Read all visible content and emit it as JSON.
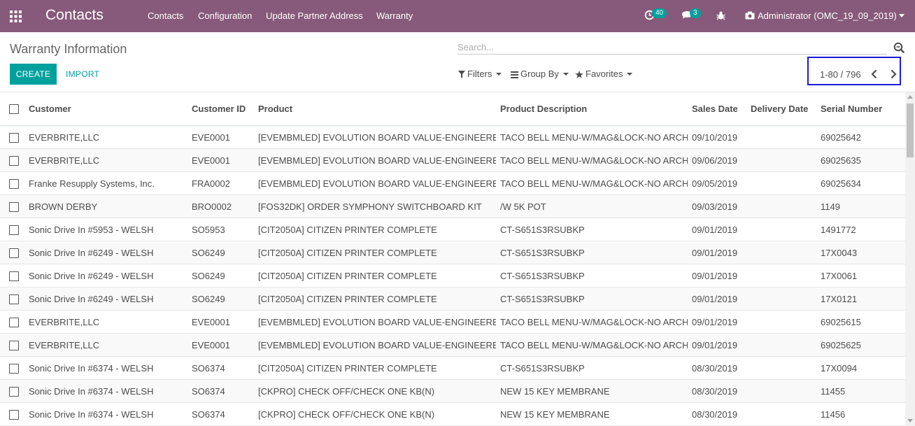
{
  "navbar": {
    "app_title": "Contacts",
    "menu": [
      "Contacts",
      "Configuration",
      "Update Partner Address",
      "Warranty"
    ],
    "activity_count": "40",
    "messages_count": "3",
    "user_label": "Administrator (OMC_19_09_2019)",
    "bg_color": "#875a7b",
    "badge_color": "#00a09d"
  },
  "control_panel": {
    "title": "Warranty Information",
    "search_placeholder": "Search...",
    "create_label": "CREATE",
    "import_label": "IMPORT",
    "filters_label": "Filters",
    "group_by_label": "Group By",
    "favorites_label": "Favorites",
    "pager_value": "1-80 / 796",
    "accent_color": "#00a09d",
    "pager_highlight_color": "#1a1adc"
  },
  "table": {
    "columns": [
      "Customer",
      "Customer ID",
      "Product",
      "Product Description",
      "Sales Date",
      "Delivery Date",
      "Serial Number"
    ],
    "rows": [
      [
        "EVERBRITE,LLC",
        "EVE0001",
        "[EVEMBMLED] EVOLUTION BOARD VALUE-ENGINEERED",
        "TACO BELL MENU-W/MAG&LOCK-NO ARCH",
        "09/10/2019",
        "",
        "69025642"
      ],
      [
        "EVERBRITE,LLC",
        "EVE0001",
        "[EVEMBMLED] EVOLUTION BOARD VALUE-ENGINEERED",
        "TACO BELL MENU-W/MAG&LOCK-NO ARCH",
        "09/06/2019",
        "",
        "69025635"
      ],
      [
        "Franke Resupply Systems, Inc.",
        "FRA0002",
        "[EVEMBMLED] EVOLUTION BOARD VALUE-ENGINEERED",
        "TACO BELL MENU-W/MAG&LOCK-NO ARCH",
        "09/05/2019",
        "",
        "69025634"
      ],
      [
        "BROWN DERBY",
        "BRO0002",
        "[FOS32DK] ORDER SYMPHONY SWITCHBOARD KIT",
        "/W 5K POT",
        "09/03/2019",
        "",
        "1149"
      ],
      [
        "Sonic Drive In #5953 - WELSH",
        "SO5953",
        "[CIT2050A] CITIZEN PRINTER COMPLETE",
        "CT-S651S3RSUBKP",
        "09/01/2019",
        "",
        "1491772"
      ],
      [
        "Sonic Drive In #6249 - WELSH",
        "SO6249",
        "[CIT2050A] CITIZEN PRINTER COMPLETE",
        "CT-S651S3RSUBKP",
        "09/01/2019",
        "",
        "17X0043"
      ],
      [
        "Sonic Drive In #6249 - WELSH",
        "SO6249",
        "[CIT2050A] CITIZEN PRINTER COMPLETE",
        "CT-S651S3RSUBKP",
        "09/01/2019",
        "",
        "17X0061"
      ],
      [
        "Sonic Drive In #6249 - WELSH",
        "SO6249",
        "[CIT2050A] CITIZEN PRINTER COMPLETE",
        "CT-S651S3RSUBKP",
        "09/01/2019",
        "",
        "17X0121"
      ],
      [
        "EVERBRITE,LLC",
        "EVE0001",
        "[EVEMBMLED] EVOLUTION BOARD VALUE-ENGINEERED",
        "TACO BELL MENU-W/MAG&LOCK-NO ARCH",
        "09/01/2019",
        "",
        "69025615"
      ],
      [
        "EVERBRITE,LLC",
        "EVE0001",
        "[EVEMBMLED] EVOLUTION BOARD VALUE-ENGINEERED",
        "TACO BELL MENU-W/MAG&LOCK-NO ARCH",
        "09/01/2019",
        "",
        "69025625"
      ],
      [
        "Sonic Drive In #6374 - WELSH",
        "SO6374",
        "[CIT2050A] CITIZEN PRINTER COMPLETE",
        "CT-S651S3RSUBKP",
        "08/30/2019",
        "",
        "17X0094"
      ],
      [
        "Sonic Drive In #6374 - WELSH",
        "SO6374",
        "[CKPRO] CHECK OFF/CHECK ONE KB(N)",
        "NEW 15 KEY MEMBRANE",
        "08/30/2019",
        "",
        "11455"
      ],
      [
        "Sonic Drive In #6374 - WELSH",
        "SO6374",
        "[CKPRO] CHECK OFF/CHECK ONE KB(N)",
        "NEW 15 KEY MEMBRANE",
        "08/30/2019",
        "",
        "11456"
      ]
    ]
  }
}
